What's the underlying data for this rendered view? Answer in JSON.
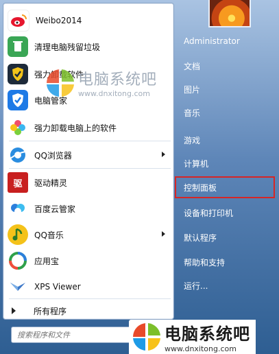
{
  "left_pane": {
    "items": [
      {
        "label": "Weibo2014",
        "icon": "weibo-icon",
        "color": "#e6162d",
        "arrow": false
      },
      {
        "label": "清理电脑残留垃圾",
        "icon": "recycle-icon",
        "color": "#3aa655",
        "arrow": false
      },
      {
        "label": "强力卸载软件",
        "icon": "uninstall-shield-icon",
        "color": "#1d2a3a",
        "arrow": false
      },
      {
        "label": "电脑管家",
        "icon": "tencent-shield-icon",
        "color": "#1e7ae6",
        "arrow": false
      },
      {
        "label": "强力卸载电脑上的软件",
        "icon": "flower-icon",
        "color": "#f2a43a",
        "arrow": false
      },
      {
        "label": "QQ浏览器",
        "icon": "qq-browser-icon",
        "color": "#2a8de0",
        "arrow": true
      },
      {
        "label": "驱动精灵",
        "icon": "driver-genius-icon",
        "color": "#c81f1f",
        "glyph": "驱",
        "arrow": false
      },
      {
        "label": "百度云管家",
        "icon": "baidu-cloud-icon",
        "color": "#2c7fdc",
        "arrow": false
      },
      {
        "label": "QQ音乐",
        "icon": "qq-music-icon",
        "color": "#f4c21a",
        "arrow": true
      },
      {
        "label": "应用宝",
        "icon": "app-store-icon",
        "color": "#2fa04a",
        "arrow": false
      },
      {
        "label": "XPS Viewer",
        "icon": "xps-viewer-icon",
        "color": "#3c78c8",
        "arrow": false
      }
    ],
    "all_programs": "所有程序",
    "search_placeholder": "搜索程序和文件"
  },
  "right_pane": {
    "items": [
      {
        "label": "Administrator"
      },
      {
        "label": "文档"
      },
      {
        "label": "图片"
      },
      {
        "label": "音乐"
      },
      {
        "label": "游戏"
      },
      {
        "label": "计算机"
      },
      {
        "label": "控制面板",
        "highlighted": true
      },
      {
        "label": "设备和打印机"
      },
      {
        "label": "默认程序"
      },
      {
        "label": "帮助和支持"
      },
      {
        "label": "运行..."
      }
    ]
  },
  "watermark": {
    "brand": "电脑系统吧",
    "url": "www.dnxitong.com"
  },
  "colors": {
    "highlight": "#d72525",
    "menu_blue": "#5e86b8"
  }
}
